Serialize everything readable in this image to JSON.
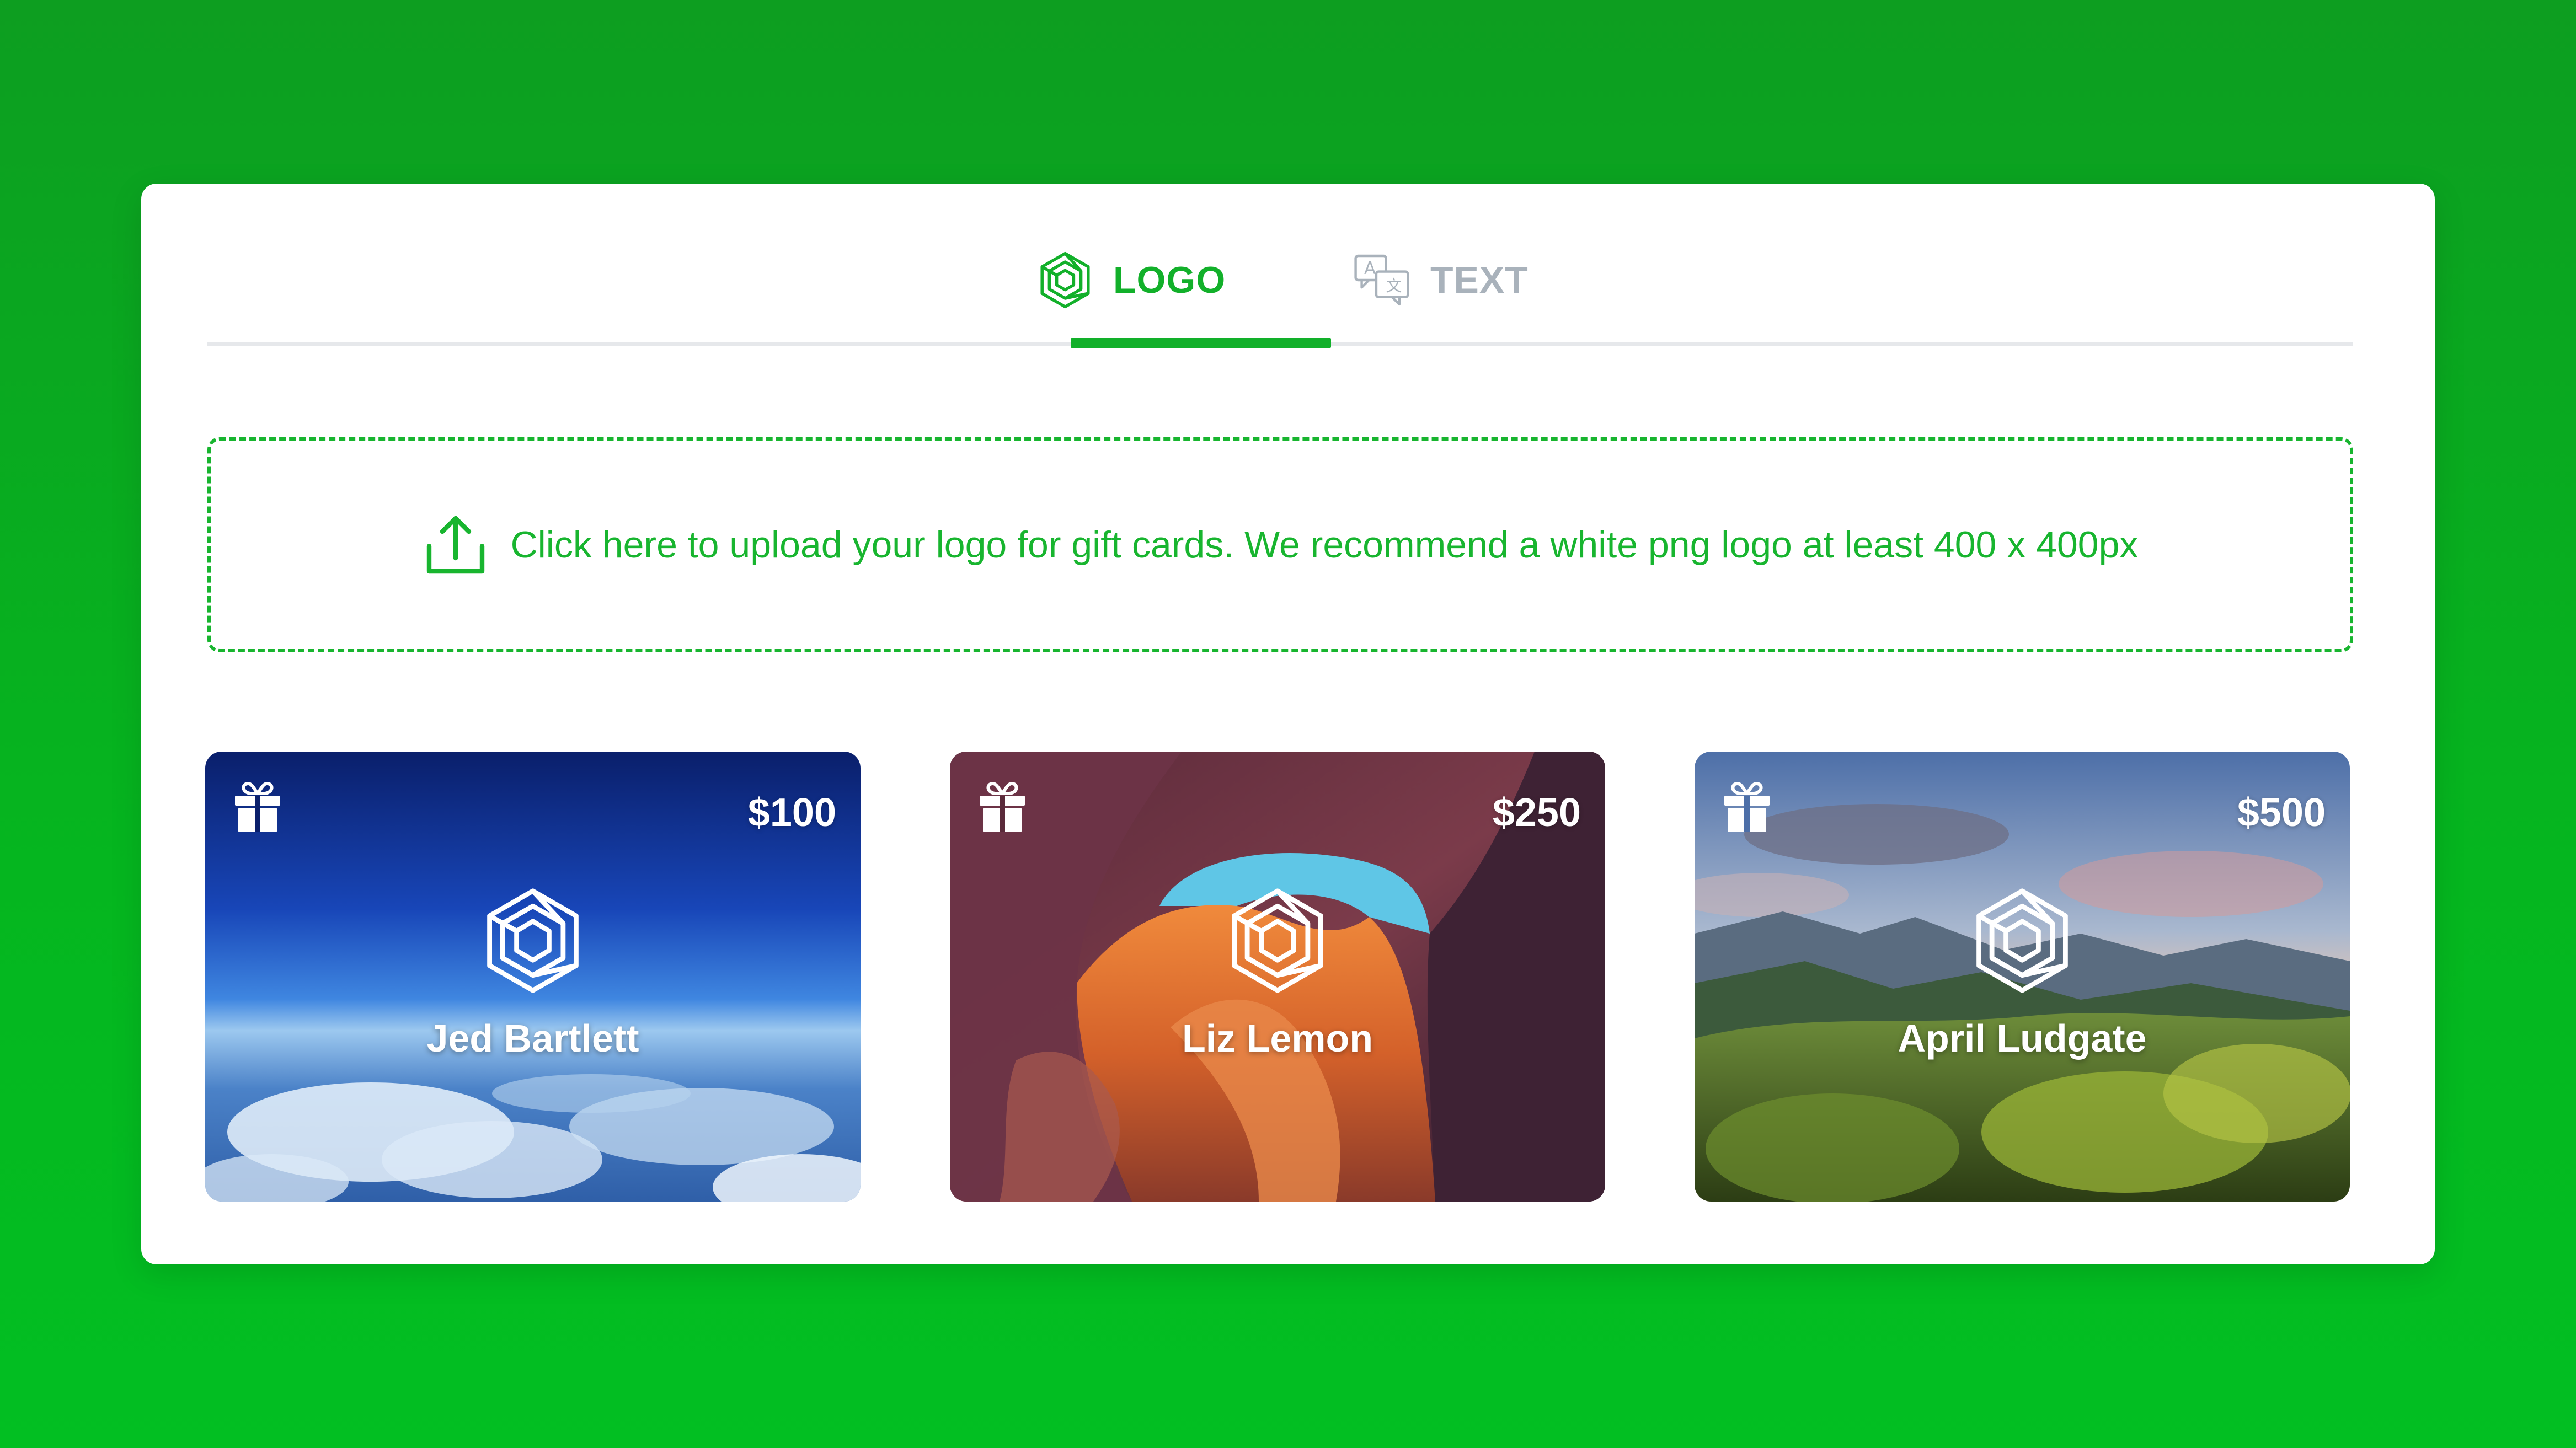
{
  "tabs": [
    {
      "label": "LOGO",
      "active": true,
      "icon": "hexagon-logo-icon"
    },
    {
      "label": "TEXT",
      "active": false,
      "icon": "translate-chat-icon"
    }
  ],
  "upload": {
    "text": "Click here to upload your logo for gift cards. We recommend a white png logo at least 400 x 400px",
    "icon": "upload-icon"
  },
  "cards": [
    {
      "amount": "$100",
      "name": "Jed Bartlett",
      "theme": "sky-earth"
    },
    {
      "amount": "$250",
      "name": "Liz Lemon",
      "theme": "canyon"
    },
    {
      "amount": "$500",
      "name": "April Ludgate",
      "theme": "mountains"
    }
  ],
  "colors": {
    "accent": "#12b02a",
    "background_top": "#0d9e20",
    "background_bottom": "#02bf22",
    "inactive_tab": "#a9b2bb",
    "panel": "#ffffff"
  }
}
